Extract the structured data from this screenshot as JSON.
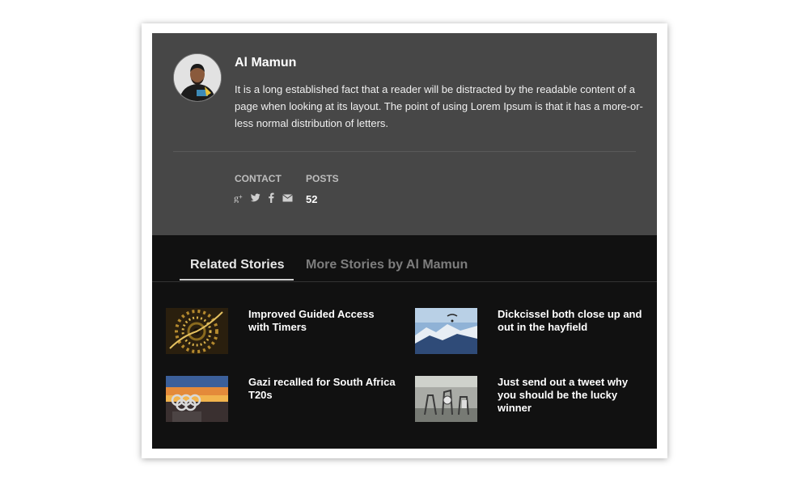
{
  "author": {
    "name": "Al Mamun",
    "bio": "It is a long established fact that a reader will be distracted by the readable content of a page when looking at its layout. The point of using Lorem Ipsum is that it has a more-or-less normal distribution of letters.",
    "contact_label": "CONTACT",
    "posts_label": "POSTS",
    "posts_count": "52",
    "social_icons": [
      "google-plus-icon",
      "twitter-icon",
      "facebook-icon",
      "email-icon"
    ]
  },
  "tabs": {
    "related": "Related Stories",
    "more_by": "More Stories by Al Mamun"
  },
  "stories": [
    {
      "title": "Improved Guided Access with Timers",
      "thumb": "spiral-fractal-image"
    },
    {
      "title": "Dickcissel both close up and out in the hayfield",
      "thumb": "paraglider-over-mountains-image"
    },
    {
      "title": "Gazi recalled for South Africa T20s",
      "thumb": "olympic-rings-sunset-image"
    },
    {
      "title": "Just send out a tweet why you should be the lucky winner",
      "thumb": "gym-equipment-image"
    }
  ],
  "colors": {
    "author_bg": "#474747",
    "card_bg": "#111111",
    "active_tab": "#e6e6e6",
    "inactive_tab": "#7d7d7d"
  }
}
